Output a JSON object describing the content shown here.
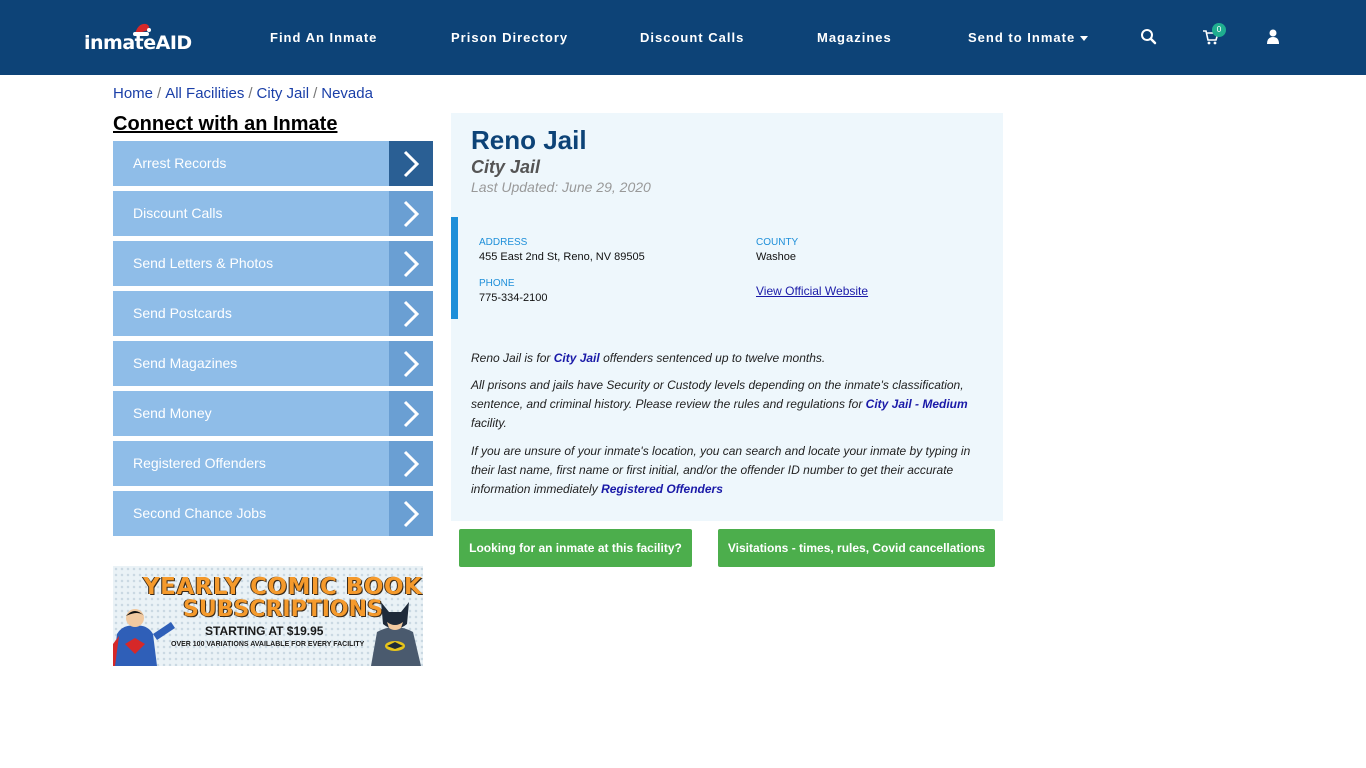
{
  "header": {
    "logo_text": "inmateAID",
    "nav": [
      {
        "label": "Find An Inmate"
      },
      {
        "label": "Prison Directory"
      },
      {
        "label": "Discount Calls"
      },
      {
        "label": "Magazines"
      },
      {
        "label": "Send to Inmate"
      }
    ],
    "cart_count": "0",
    "icons": [
      "search-icon",
      "cart-icon",
      "user-icon"
    ],
    "bg_color": "#0d4377"
  },
  "breadcrumb": {
    "items": [
      "Home",
      "All Facilities",
      "City Jail",
      "Nevada"
    ],
    "separator": "/"
  },
  "sidebar": {
    "title": "Connect with an Inmate",
    "items": [
      {
        "label": "Arrest Records"
      },
      {
        "label": "Discount Calls"
      },
      {
        "label": "Send Letters & Photos"
      },
      {
        "label": "Send Postcards"
      },
      {
        "label": "Send Magazines"
      },
      {
        "label": "Send Money"
      },
      {
        "label": "Registered Offenders"
      },
      {
        "label": "Second Chance Jobs"
      }
    ]
  },
  "banner": {
    "line1": "YEARLY COMIC BOOK",
    "line2": "SUBSCRIPTIONS",
    "line3": "STARTING AT $19.95",
    "line4": "OVER 100 VARIATIONS AVAILABLE FOR EVERY FACILITY"
  },
  "facility": {
    "name": "Reno Jail",
    "type": "City Jail",
    "last_updated": "Last Updated: June 29, 2020",
    "address_label": "ADDRESS",
    "address": "455 East 2nd St, Reno, NV 89505",
    "county_label": "COUNTY",
    "county": "Washoe",
    "phone_label": "PHONE",
    "phone": "775-334-2100",
    "website_link": "View Official Website",
    "desc1_pre": "Reno Jail is for ",
    "desc1_link": "City Jail",
    "desc1_post": " offenders sentenced up to twelve months.",
    "desc2_pre": "All prisons and jails have Security or Custody levels depending on the inmate's classification, sentence, and criminal history. Please review the rules and regulations for ",
    "desc2_link": "City Jail - Medium",
    "desc2_post": " facility.",
    "desc3_pre": "If you are unsure of your inmate's location, you can search and locate your inmate by typing in their last name, first name or first initial, and/or the offender ID number to get their accurate information immediately ",
    "desc3_link": "Registered Offenders"
  },
  "buttons": {
    "looking": "Looking for an inmate at this facility?",
    "visitations": "Visitations - times, rules, Covid cancellations"
  },
  "colors": {
    "accent_blue": "#1e8fd9",
    "sidebar_item": "#8fbde8",
    "button_green": "#4cae4c"
  }
}
